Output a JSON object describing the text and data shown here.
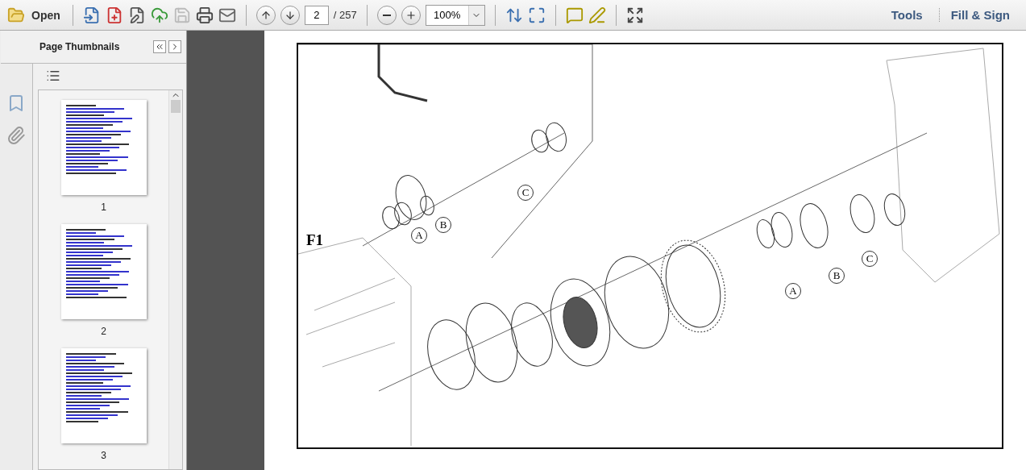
{
  "toolbar": {
    "open_label": "Open",
    "page_number": "2",
    "page_total": "/ 257",
    "zoom": "100%",
    "links": [
      "Tools",
      "Fill & Sign"
    ]
  },
  "sidebar": {
    "title": "Page Thumbnails",
    "thumbnails": [
      {
        "label": "1"
      },
      {
        "label": "2"
      },
      {
        "label": "3"
      }
    ]
  },
  "figure": {
    "panel_label": "F1",
    "callouts": [
      "A",
      "B",
      "C",
      "A",
      "B",
      "C"
    ]
  }
}
